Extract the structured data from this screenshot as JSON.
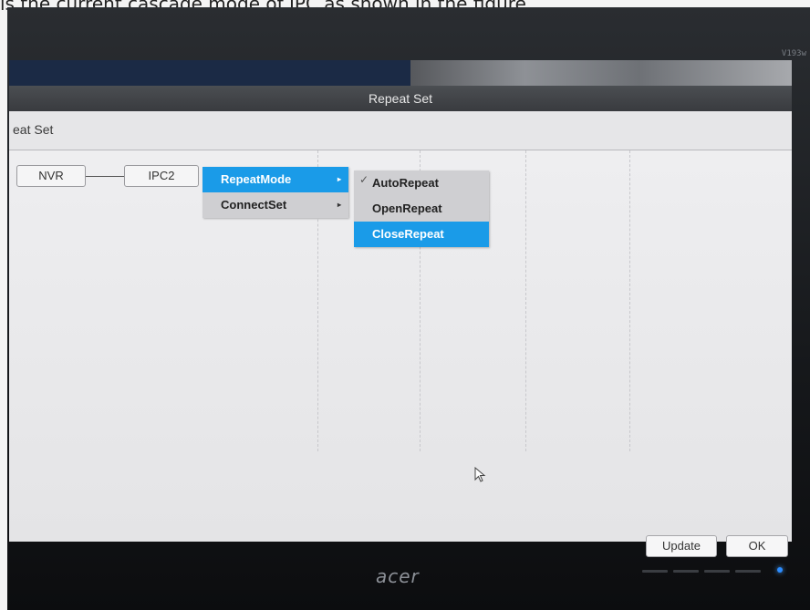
{
  "caption": "is the current cascade mode of IPC as shown in the figure.",
  "monitor": {
    "brand": "acer",
    "model_label": "V193w",
    "led_color": "#2c8cff"
  },
  "window": {
    "title": "Repeat Set",
    "tab_label": "eat Set"
  },
  "topology": {
    "nodes": [
      "NVR",
      "IPC2"
    ]
  },
  "context_menu": {
    "items": [
      {
        "label": "RepeatMode",
        "has_submenu": true,
        "selected": true
      },
      {
        "label": "ConnectSet",
        "has_submenu": true,
        "selected": false
      }
    ]
  },
  "submenu": {
    "items": [
      {
        "label": "AutoRepeat",
        "checked": true,
        "selected": false
      },
      {
        "label": "OpenRepeat",
        "checked": false,
        "selected": false
      },
      {
        "label": "CloseRepeat",
        "checked": false,
        "selected": true
      }
    ]
  },
  "buttons": {
    "update": "Update",
    "ok": "OK"
  },
  "colors": {
    "selection": "#1a9be8",
    "menu_background": "#cfcfd2"
  },
  "icons": {
    "check": "✓",
    "submenu_arrow": "▸"
  }
}
